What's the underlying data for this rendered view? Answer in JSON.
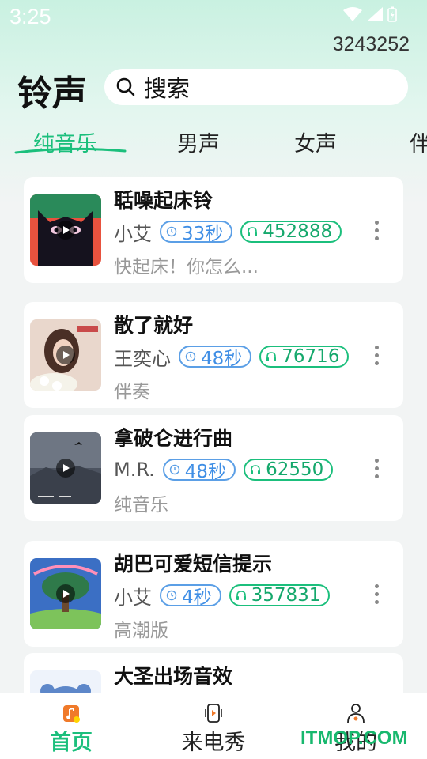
{
  "status_bar": {
    "time": "3:25"
  },
  "header": {
    "counter": "3243252",
    "title": "铃声",
    "search_label": "搜索"
  },
  "tabs": [
    {
      "label": "纯音乐",
      "active": true
    },
    {
      "label": "男声",
      "active": false
    },
    {
      "label": "女声",
      "active": false
    },
    {
      "label": "伴",
      "active": false
    }
  ],
  "songs": [
    {
      "title": "聒噪起床铃",
      "artist": "小艾",
      "duration": "33秒",
      "plays": "452888",
      "subtitle": "快起床！你怎么..."
    },
    {
      "title": "散了就好",
      "artist": "王奕心",
      "duration": "48秒",
      "plays": "76716",
      "subtitle": "伴奏"
    },
    {
      "title": "拿破仑进行曲",
      "artist": "M.R.",
      "duration": "48秒",
      "plays": "62550",
      "subtitle": "纯音乐"
    },
    {
      "title": "胡巴可爱短信提示",
      "artist": "小艾",
      "duration": "4秒",
      "plays": "357831",
      "subtitle": "高潮版"
    },
    {
      "title": "大圣出场音效"
    }
  ],
  "bottom_nav": [
    {
      "label": "首页",
      "active": true
    },
    {
      "label": "来电秀",
      "active": false
    },
    {
      "label": "我的",
      "active": false
    }
  ],
  "watermark": "ITMOP.COM",
  "colors": {
    "accent": "#1bbf7c",
    "duration": "#3f8ee5"
  }
}
